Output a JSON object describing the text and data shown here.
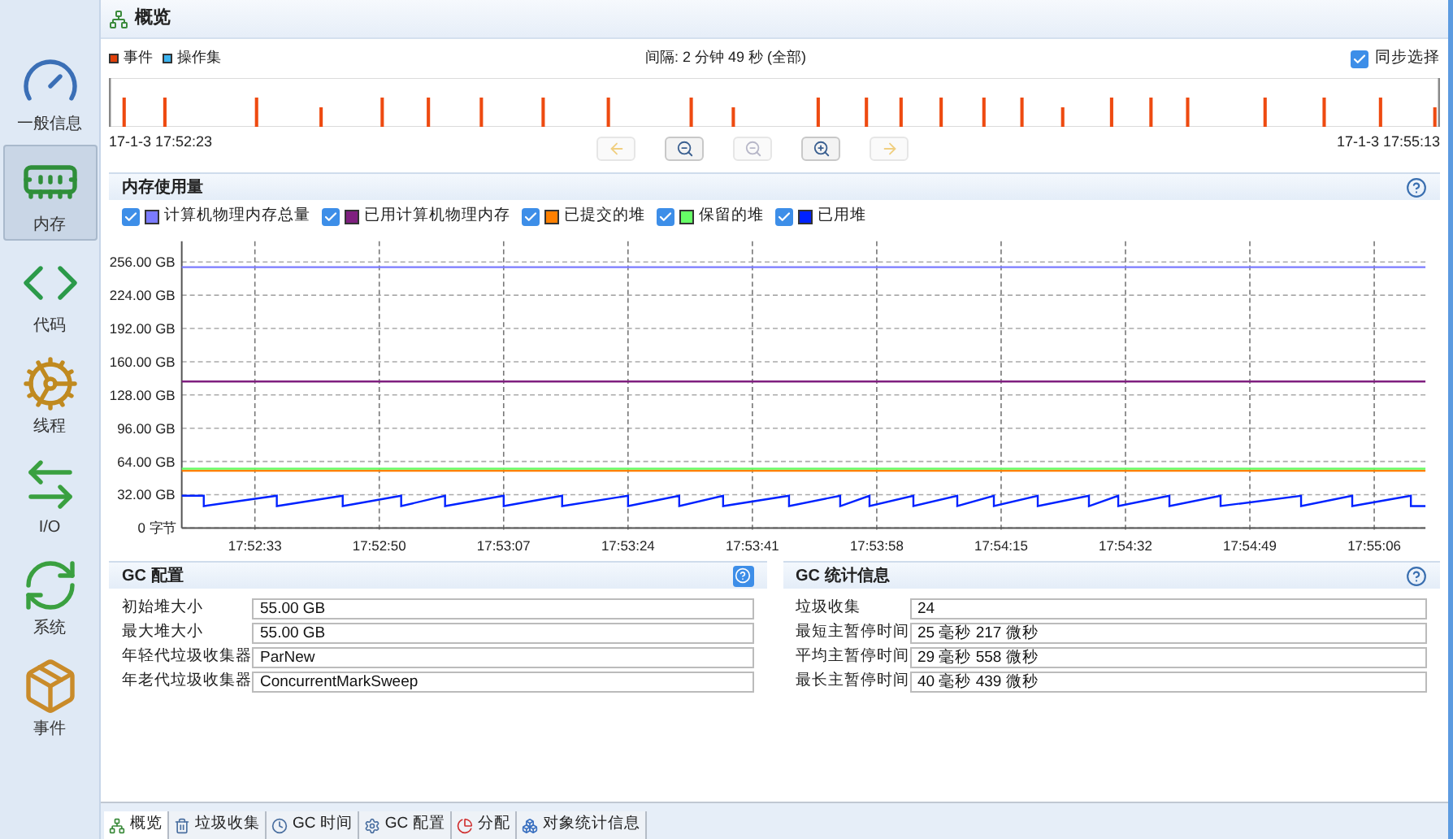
{
  "header": {
    "title": "概览"
  },
  "sidebar": {
    "items": [
      {
        "kind": "general",
        "label": "一般信息",
        "selected": false
      },
      {
        "kind": "memory",
        "label": "内存",
        "selected": true
      },
      {
        "kind": "code",
        "label": "代码",
        "selected": false
      },
      {
        "kind": "threads",
        "label": "线程",
        "selected": false
      },
      {
        "kind": "io",
        "label": "I/O",
        "selected": false
      },
      {
        "kind": "system",
        "label": "系统",
        "selected": false
      },
      {
        "kind": "events",
        "label": "事件",
        "selected": false
      }
    ]
  },
  "timeline": {
    "legend": [
      {
        "label": "事件",
        "color": "#e0400a"
      },
      {
        "label": "操作集",
        "color": "#3cb4f0"
      }
    ],
    "interval": "间隔: 2 分钟 49 秒 (全部)",
    "sync": {
      "label": "同步选择",
      "checked": true
    },
    "start": "17-1-3 17:52:23",
    "end": "17-1-3 17:55:13",
    "buttons": [
      {
        "kind": "back",
        "disabled": true
      },
      {
        "kind": "zoom-out",
        "disabled": false
      },
      {
        "kind": "zoom-out",
        "disabled": true
      },
      {
        "kind": "zoom-in",
        "disabled": false
      },
      {
        "kind": "forward",
        "disabled": true
      }
    ]
  },
  "memory": {
    "title": "内存使用量",
    "legend": [
      {
        "checked": true
      },
      {
        "checked": true
      },
      {
        "checked": true
      },
      {
        "checked": true
      },
      {
        "checked": true
      }
    ],
    "chart_data": {
      "type": "line",
      "x": [
        64343,
        64346,
        64346,
        64356,
        64356,
        64365,
        64365,
        64373,
        64373,
        64379,
        64379,
        64387,
        64387,
        64395,
        64395,
        64404,
        64404,
        64411,
        64411,
        64417,
        64417,
        64426,
        64426,
        64433,
        64433,
        64437,
        64437,
        64443,
        64443,
        64449,
        64449,
        64454,
        64454,
        64460,
        64460,
        64467,
        64467,
        64471,
        64471,
        64478,
        64478,
        64485,
        64485,
        64496,
        64496,
        64503,
        64503,
        64511,
        64511,
        64513
      ],
      "xlim": [
        64343,
        64513
      ],
      "ylim": [
        0,
        276
      ],
      "grid": true,
      "xticks": [
        {
          "value": 64353,
          "label": "17:52:33"
        },
        {
          "value": 64370,
          "label": "17:52:50"
        },
        {
          "value": 64387,
          "label": "17:53:07"
        },
        {
          "value": 64404,
          "label": "17:53:24"
        },
        {
          "value": 64421,
          "label": "17:53:41"
        },
        {
          "value": 64438,
          "label": "17:53:58"
        },
        {
          "value": 64455,
          "label": "17:54:15"
        },
        {
          "value": 64472,
          "label": "17:54:32"
        },
        {
          "value": 64489,
          "label": "17:54:49"
        },
        {
          "value": 64506,
          "label": "17:55:06"
        }
      ],
      "yticks": [
        {
          "value": 0,
          "label": "0 字节"
        },
        {
          "value": 32,
          "label": "32.00 GB"
        },
        {
          "value": 64,
          "label": "64.00 GB"
        },
        {
          "value": 96,
          "label": "96.00 GB"
        },
        {
          "value": 128,
          "label": "128.00 GB"
        },
        {
          "value": 160,
          "label": "160.00 GB"
        },
        {
          "value": 192,
          "label": "192.00 GB"
        },
        {
          "value": 224,
          "label": "224.00 GB"
        },
        {
          "value": 256,
          "label": "256.00 GB"
        }
      ],
      "series": [
        {
          "name": "计算机物理内存总量",
          "color": "#7b7bff",
          "values": [
            251,
            251,
            251,
            251,
            251,
            251,
            251,
            251,
            251,
            251,
            251,
            251,
            251,
            251,
            251,
            251,
            251,
            251,
            251,
            251,
            251,
            251,
            251,
            251,
            251,
            251,
            251,
            251,
            251,
            251,
            251,
            251,
            251,
            251,
            251,
            251,
            251,
            251,
            251,
            251,
            251,
            251,
            251,
            251,
            251,
            251,
            251,
            251,
            251,
            251
          ]
        },
        {
          "name": "已用计算机物理内存",
          "color": "#7f1f7f",
          "values": [
            141,
            141,
            141,
            141,
            141,
            141,
            141,
            141,
            141,
            141,
            141,
            141,
            141,
            141,
            141,
            141,
            141,
            141,
            141,
            141,
            141,
            141,
            141,
            141,
            141,
            141,
            141,
            141,
            141,
            141,
            141,
            141,
            141,
            141,
            141,
            141,
            141,
            141,
            141,
            141,
            141,
            141,
            141,
            141,
            141,
            141,
            141,
            141,
            141,
            141
          ]
        },
        {
          "name": "已提交的堆",
          "color": "#ff8000",
          "values": [
            55,
            55,
            55,
            55,
            55,
            55,
            55,
            55,
            55,
            55,
            55,
            55,
            55,
            55,
            55,
            55,
            55,
            55,
            55,
            55,
            55,
            55,
            55,
            55,
            55,
            55,
            55,
            55,
            55,
            55,
            55,
            55,
            55,
            55,
            55,
            55,
            55,
            55,
            55,
            55,
            55,
            55,
            55,
            55,
            55,
            55,
            55,
            55,
            55,
            55
          ]
        },
        {
          "name": "保留的堆",
          "color": "#66ff66",
          "values": [
            57,
            57,
            57,
            57,
            57,
            57,
            57,
            57,
            57,
            57,
            57,
            57,
            57,
            57,
            57,
            57,
            57,
            57,
            57,
            57,
            57,
            57,
            57,
            57,
            57,
            57,
            57,
            57,
            57,
            57,
            57,
            57,
            57,
            57,
            57,
            57,
            57,
            57,
            57,
            57,
            57,
            57,
            57,
            57,
            57,
            57,
            57,
            57,
            57,
            57
          ]
        },
        {
          "name": "已用堆",
          "color": "#0022ff",
          "values": [
            31,
            31,
            21,
            31,
            21,
            31,
            21,
            31,
            21,
            31,
            21,
            31,
            21,
            31,
            21,
            31,
            21,
            31,
            21,
            31,
            21,
            31,
            21,
            31,
            21,
            31,
            21,
            31,
            21,
            31,
            21,
            31,
            21,
            31,
            21,
            31,
            21,
            31,
            21,
            31,
            21,
            31,
            21,
            31,
            21,
            31,
            21,
            31,
            21,
            21
          ]
        }
      ]
    }
  },
  "gc_config": {
    "title": "GC 配置",
    "fields": [
      {
        "label": "初始堆大小",
        "value": "55.00 GB"
      },
      {
        "label": "最大堆大小",
        "value": "55.00 GB"
      },
      {
        "label": "年轻代垃圾收集器",
        "value": "ParNew"
      },
      {
        "label": "年老代垃圾收集器",
        "value": "ConcurrentMarkSweep"
      }
    ]
  },
  "gc_stats": {
    "title": "GC 统计信息",
    "fields": [
      {
        "label": "垃圾收集",
        "value": "24"
      },
      {
        "label": "最短主暂停时间",
        "value": "25 毫秒 217 微秒"
      },
      {
        "label": "平均主暂停时间",
        "value": "29 毫秒 558 微秒"
      },
      {
        "label": "最长主暂停时间",
        "value": "40 毫秒 439 微秒"
      }
    ]
  },
  "tabs": [
    {
      "kind": "overview",
      "label": "概览",
      "selected": true
    },
    {
      "kind": "gc",
      "label": "垃圾收集",
      "selected": false
    },
    {
      "kind": "gc-time",
      "label": "GC 时间",
      "selected": false
    },
    {
      "kind": "gc-config",
      "label": "GC 配置",
      "selected": false
    },
    {
      "kind": "allocation",
      "label": "分配",
      "selected": false
    },
    {
      "kind": "objects",
      "label": "对象统计信息",
      "selected": false
    }
  ]
}
